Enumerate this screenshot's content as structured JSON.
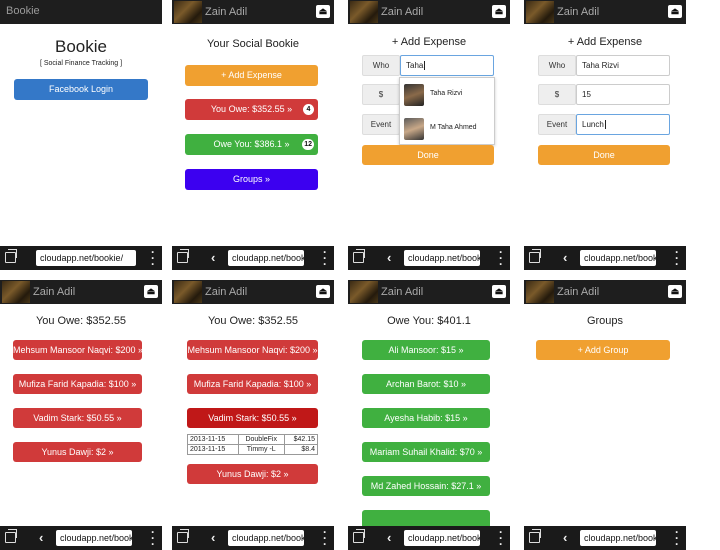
{
  "header": {
    "app_title": "Bookie",
    "user_name": "Zain Adil",
    "logout_glyph": "⏏"
  },
  "browser": {
    "url_full": "cloudapp.net/bookie/",
    "url_short": "cloudapp.net/booki",
    "back_glyph": "‹",
    "menu_glyph": "⋮"
  },
  "login": {
    "title": "Bookie",
    "subtitle": "[ Social Finance Tracking ]",
    "login_button": "Facebook Login"
  },
  "home": {
    "title": "Your Social Bookie",
    "add_expense": "+ Add Expense",
    "you_owe": "You Owe: $352.55 »",
    "you_owe_count": "4",
    "owe_you": "Owe You: $386.1 »",
    "owe_you_count": "12",
    "groups": "Groups »"
  },
  "add_expense": {
    "title": "+ Add Expense",
    "who_label": "Who",
    "amount_label": "$",
    "event_label": "Event",
    "done": "Done",
    "typing": {
      "who_value": "Taha",
      "suggestions": [
        "Taha Rizvi",
        "M Taha Ahmed"
      ]
    },
    "filled": {
      "who_value": "Taha Rizvi",
      "amount_value": "15",
      "event_value": "Lunch"
    }
  },
  "you_owe": {
    "title": "You Owe: $352.55",
    "items": [
      "Mehsum Mansoor Naqvi: $200 »",
      "Mufiza Farid Kapadia: $100 »",
      "Vadim Stark: $50.55 »",
      "Yunus Dawji: $2 »"
    ],
    "transactions": [
      {
        "date": "2013-11-15",
        "event": "DoubleFix",
        "amount": "$42.15"
      },
      {
        "date": "2013-11-15",
        "event": "Timmy -L",
        "amount": "$8.4"
      }
    ]
  },
  "owe_you": {
    "title": "Owe You: $401.1",
    "items": [
      "Ali Mansoor: $15 »",
      "Archan Barot: $10 »",
      "Ayesha Habib: $15 »",
      "Mariam Suhail Khalid: $70 »",
      "Md Zahed Hossain: $27.1 »"
    ]
  },
  "groups": {
    "title": "Groups",
    "add_group": "+ Add Group"
  },
  "colors": {
    "header_bg": "#1e1e1e",
    "orange": "#f0a030",
    "red": "#d03a3a",
    "green": "#40b040",
    "blue": "#3478c8",
    "purple": "#3c00f0"
  }
}
